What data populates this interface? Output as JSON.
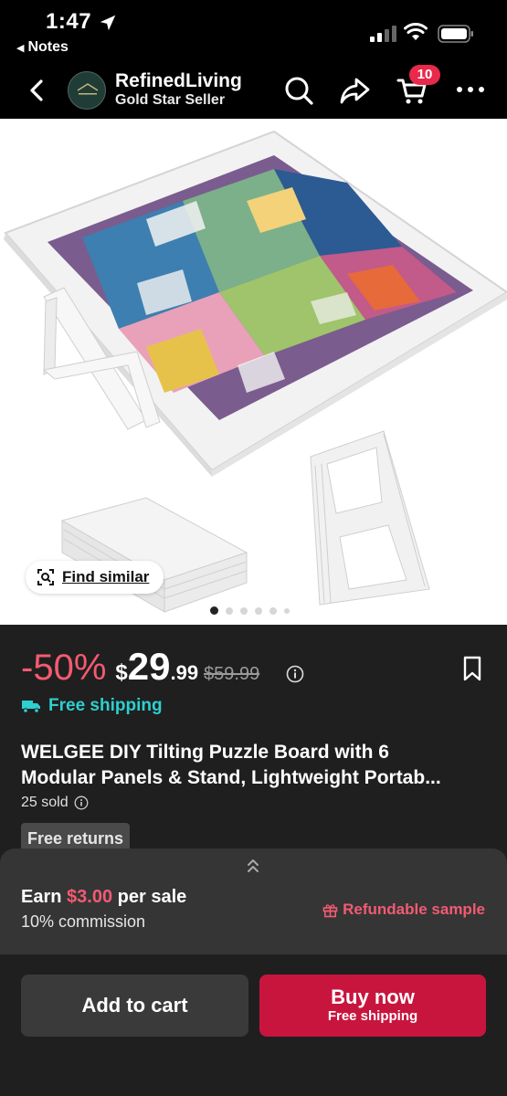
{
  "status_bar": {
    "time": "1:47",
    "back_app": "Notes"
  },
  "nav": {
    "store_name": "RefinedLiving",
    "store_badge": "Gold Star Seller",
    "cart_count": "10"
  },
  "gallery": {
    "find_similar": "Find similar",
    "image_count": 6,
    "active_index": 0
  },
  "product": {
    "discount": "-50%",
    "currency": "$",
    "price_whole": "29",
    "price_cents": ".99",
    "original_price": "$59.99",
    "shipping": "Free shipping",
    "title_line1": "WELGEE DIY Tilting Puzzle Board with 6",
    "title_line2": "Modular Panels & Stand, Lightweight Portab...",
    "sold": "25 sold",
    "returns_tag": "Free returns"
  },
  "affiliate": {
    "earn_prefix": "Earn",
    "earn_amount": "$3.00",
    "earn_suffix": "per sale",
    "commission": "10% commission",
    "refundable": "Refundable sample"
  },
  "actions": {
    "add_to_cart": "Add to cart",
    "buy_now": "Buy now",
    "buy_now_sub": "Free shipping"
  },
  "colors": {
    "accent_red": "#c8153e",
    "discount_pink": "#f25b72",
    "shipping_teal": "#2ecfcf",
    "badge_red": "#e8294c"
  }
}
